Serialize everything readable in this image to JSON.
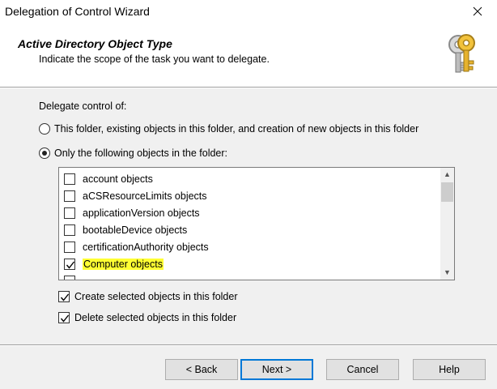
{
  "window": {
    "title": "Delegation of Control Wizard"
  },
  "header": {
    "title": "Active Directory Object Type",
    "subtitle": "Indicate the scope of the task you want to delegate."
  },
  "delegate": {
    "label": "Delegate control of:",
    "option_all": "This folder, existing objects in this folder, and creation of new objects in this folder",
    "option_following": "Only the following objects in the folder:",
    "selected_option": "following"
  },
  "objects": [
    {
      "label": "account objects",
      "checked": false
    },
    {
      "label": "aCSResourceLimits objects",
      "checked": false
    },
    {
      "label": "applicationVersion objects",
      "checked": false
    },
    {
      "label": "bootableDevice objects",
      "checked": false
    },
    {
      "label": "certificationAuthority objects",
      "checked": false
    },
    {
      "label": "Computer objects",
      "checked": true,
      "highlighted": true
    }
  ],
  "options": {
    "create": "Create selected objects in this folder",
    "delete": "Delete selected objects in this folder"
  },
  "buttons": {
    "back": "< Back",
    "next": "Next >",
    "cancel": "Cancel",
    "help": "Help"
  },
  "colors": {
    "highlight": "#ffff33",
    "focus_border": "#0078d7"
  }
}
